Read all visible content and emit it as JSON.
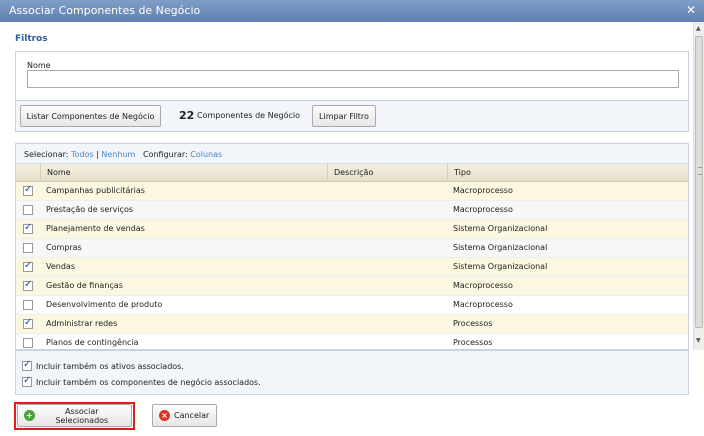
{
  "window": {
    "title": "Associar Componentes de Negócio",
    "close_glyph": "✕"
  },
  "filters": {
    "section_title": "Filtros",
    "name_label": "Nome",
    "name_value": "",
    "list_button": "Listar Componentes de Negócio",
    "count_number": "22",
    "count_label": "Componentes de Negócio",
    "clear_button": "Limpar Filtro"
  },
  "grid": {
    "select_label": "Selecionar:",
    "all_link": "Todos",
    "separator": "|",
    "none_link": "Nenhum",
    "configure_label": "Configurar:",
    "columns_link": "Colunas",
    "headers": {
      "name": "Nome",
      "description": "Descrição",
      "type": "Tipo"
    },
    "rows": [
      {
        "checked": true,
        "name": "Campanhas publicitárias",
        "description": "",
        "type": "Macroprocesso"
      },
      {
        "checked": false,
        "name": "Prestação de serviços",
        "description": "",
        "type": "Macroprocesso"
      },
      {
        "checked": true,
        "name": "Planejamento de vendas",
        "description": "",
        "type": "Sistema Organizacional"
      },
      {
        "checked": false,
        "name": "Compras",
        "description": "",
        "type": "Sistema Organizacional"
      },
      {
        "checked": true,
        "name": "Vendas",
        "description": "",
        "type": "Sistema Organizacional"
      },
      {
        "checked": true,
        "name": "Gestão de finanças",
        "description": "",
        "type": "Macroprocesso"
      },
      {
        "checked": false,
        "name": "Desenvolvimento de produto",
        "description": "",
        "type": "Macroprocesso"
      },
      {
        "checked": true,
        "name": "Administrar redes",
        "description": "",
        "type": "Processos"
      },
      {
        "checked": false,
        "name": "Planos de contingência",
        "description": "",
        "type": "Processos"
      }
    ]
  },
  "options": {
    "include_assets": {
      "label": "Incluir também os ativos associados.",
      "checked": true
    },
    "include_components": {
      "label": "Incluir também os componentes de negócio associados.",
      "checked": true
    }
  },
  "footer": {
    "associate_button": "Associar Selecionados",
    "cancel_button": "Cancelar"
  },
  "colors": {
    "title_bar": "#6d8dbd",
    "link": "#4a86c6",
    "checked_row": "#fcf7e1",
    "header": "#ece5cf",
    "highlight": "#e01c1c"
  }
}
